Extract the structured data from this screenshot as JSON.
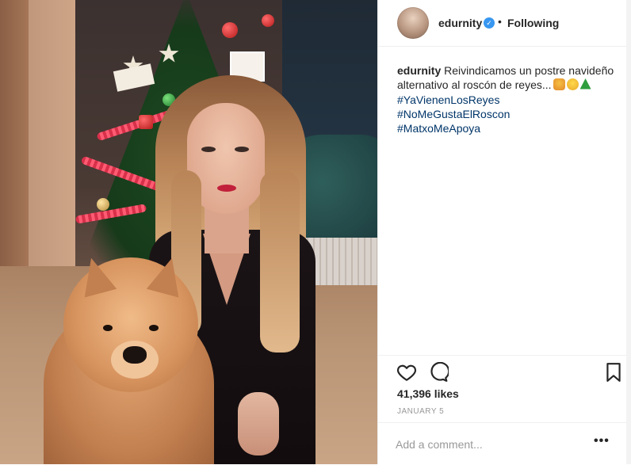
{
  "post": {
    "image_alt": "Photo of a woman in a black dress with a chow chow dog in front of a Christmas tree"
  },
  "header": {
    "username": "edurnity",
    "verified_badge": "✓",
    "separator": "•",
    "follow_status": "Following"
  },
  "caption": {
    "username": "edurnity",
    "text": "Reivindicamos un postre navideño alternativo al roscón de reyes...",
    "emojis": [
      "lion-face-emoji",
      "slightly-frowning-face-emoji",
      "christmas-tree-emoji"
    ],
    "hashtags": [
      "#YaVienenLosReyes",
      "#NoMeGustaElRoscon",
      "#MatxoMeApoya"
    ]
  },
  "actions": {
    "like_icon": "heart-icon",
    "comment_icon": "comment-bubble-icon",
    "save_icon": "bookmark-icon"
  },
  "stats": {
    "likes": "41,396 likes",
    "date": "JANUARY 5"
  },
  "comment_box": {
    "placeholder": "Add a comment...",
    "more_label": "•••"
  },
  "colors": {
    "link": "#003569",
    "verified": "#3897f0",
    "muted": "#999999",
    "text": "#262626"
  }
}
